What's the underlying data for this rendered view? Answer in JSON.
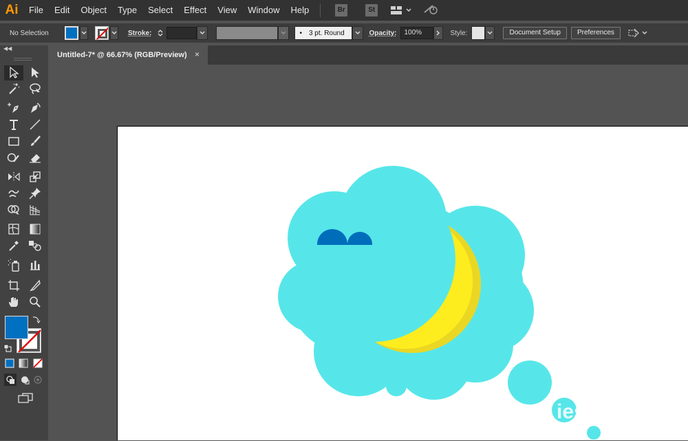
{
  "app": {
    "logo": "Ai"
  },
  "menu": {
    "items": [
      "File",
      "Edit",
      "Object",
      "Type",
      "Select",
      "Effect",
      "View",
      "Window",
      "Help"
    ]
  },
  "bridge": {
    "br": "Br",
    "st": "St"
  },
  "control_bar": {
    "selection": "No Selection",
    "stroke_label": "Stroke:",
    "brush": "3 pt. Round",
    "brush_dot": "•",
    "opacity_label": "Opacity:",
    "opacity_value": "100%",
    "style_label": "Style:",
    "document_setup": "Document Setup",
    "preferences": "Preferences"
  },
  "document": {
    "tab_title": "Untitled-7* @ 66.67% (RGB/Preview)",
    "close": "×"
  },
  "colors": {
    "fill": "#0070c0",
    "cloud": "#56e6e9",
    "moon": "#fded1e",
    "moon_shadow": "#ead724",
    "small_cloud": "#006dbb",
    "app_logo": "#ff9a00"
  },
  "watermark": {
    "text": "ies"
  }
}
